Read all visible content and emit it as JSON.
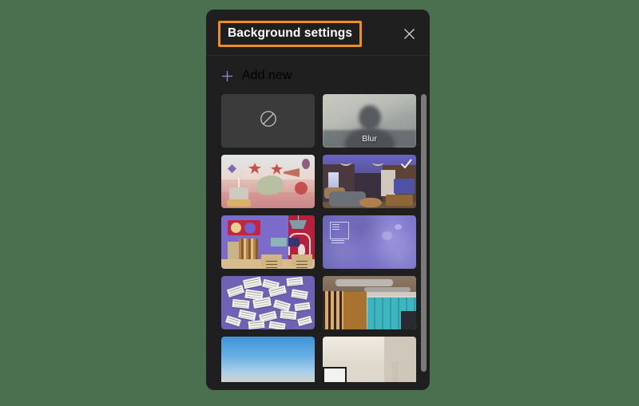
{
  "page": {
    "background_color": "#4a7050"
  },
  "panel": {
    "title": "Background settings",
    "title_highlight_color": "#f08c28",
    "close_icon": "close-icon",
    "background_color": "#1f1f1f"
  },
  "add_new": {
    "label": "Add new",
    "icon": "plus-icon",
    "accent_color": "#8b8ce0"
  },
  "effects": [
    {
      "id": "none",
      "label": "",
      "icon": "no-background-icon",
      "selected": false,
      "highlighted": false
    },
    {
      "id": "blur",
      "label": "Blur",
      "icon": "blur-thumbnail",
      "selected": false,
      "highlighted": true,
      "highlight_color": "#f08c28"
    }
  ],
  "backgrounds": [
    {
      "id": "party-pastel",
      "name": "pastel-party-illustration",
      "selected": false
    },
    {
      "id": "living-room",
      "name": "living-room-photo",
      "selected": true,
      "selected_border_color": "#9fa0e8",
      "check_icon": "check-icon"
    },
    {
      "id": "colorful-room",
      "name": "colorful-room-illustration",
      "selected": false
    },
    {
      "id": "purple-abstract",
      "name": "purple-abstract-frame",
      "selected": false
    },
    {
      "id": "sticky-notes",
      "name": "sticky-notes-illustration",
      "selected": false
    },
    {
      "id": "office-lockers",
      "name": "office-lockers-photo",
      "selected": false
    },
    {
      "id": "blue-sky",
      "name": "blue-sky-photo",
      "selected": false
    },
    {
      "id": "white-room",
      "name": "white-room-photo",
      "selected": false
    }
  ],
  "scrollbar": {
    "name": "vertical-scrollbar",
    "color": "#7a7a7a"
  }
}
